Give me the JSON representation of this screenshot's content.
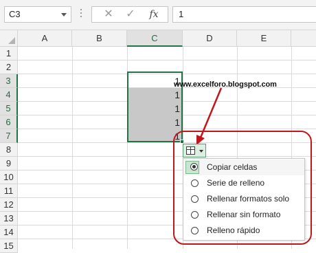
{
  "formula_bar": {
    "name_box": "C3",
    "cancel_icon": "cancel-icon",
    "enter_icon": "check-icon",
    "fx_label": "fx",
    "formula_value": "1"
  },
  "columns": [
    "A",
    "B",
    "C",
    "D",
    "E"
  ],
  "selected_column": "C",
  "rows": [
    "1",
    "2",
    "3",
    "4",
    "5",
    "6",
    "7",
    "8",
    "9",
    "10",
    "11",
    "12",
    "13",
    "14",
    "15"
  ],
  "selected_rows": [
    "3",
    "4",
    "5",
    "6",
    "7"
  ],
  "cells": {
    "C3": "1",
    "C4": "1",
    "C5": "1",
    "C6": "1",
    "C7": "1"
  },
  "watermark": "www.excelforo.blogspot.com",
  "autofill_options": {
    "button_icon": "autofill-options-icon",
    "items": [
      {
        "label": "Copiar celdas",
        "selected": true
      },
      {
        "label": "Serie de relleno",
        "selected": false
      },
      {
        "label": "Rellenar formatos solo",
        "selected": false
      },
      {
        "label": "Rellenar sin formato",
        "selected": false
      },
      {
        "label": "Relleno rápido",
        "selected": false
      }
    ]
  },
  "colors": {
    "accent_green": "#217346",
    "annotation_red": "#c0161b",
    "selection_fill": "#c8c8c8"
  }
}
